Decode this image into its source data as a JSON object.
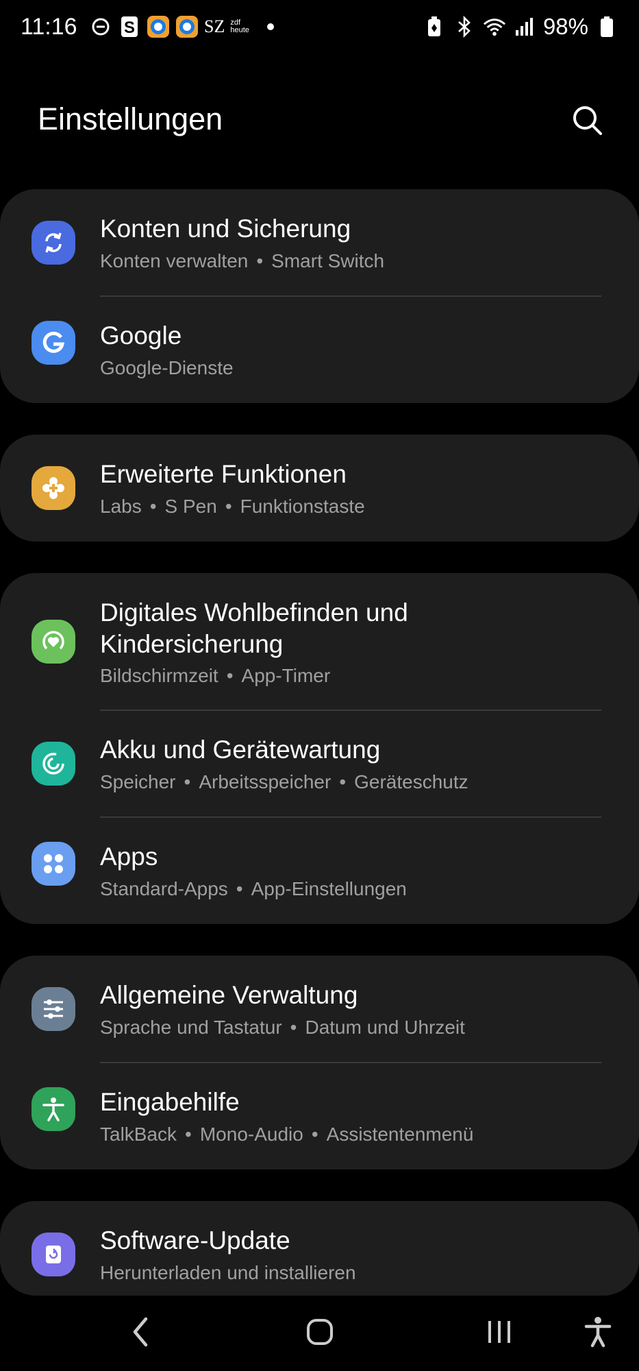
{
  "status": {
    "time": "11:16",
    "battery": "98%",
    "sz_label": "SZ",
    "zdf_label": "zdf heute"
  },
  "header": {
    "title": "Einstellungen"
  },
  "items": [
    {
      "title": "Konten und Sicherung",
      "subs": [
        "Konten verwalten",
        "Smart Switch"
      ],
      "icon": "sync-icon",
      "color": "#4a6ae0"
    },
    {
      "title": "Google",
      "subs": [
        "Google-Dienste"
      ],
      "icon": "google-icon",
      "color": "#4a8cf0"
    },
    {
      "title": "Erweiterte Funktionen",
      "subs": [
        "Labs",
        "S Pen",
        "Funktionstaste"
      ],
      "icon": "puzzle-icon",
      "color": "#e5a83c"
    },
    {
      "title": "Digitales Wohlbefinden und Kindersicherung",
      "title_line1": "Digitales Wohlbefinden und",
      "title_line2": "Kindersicherung",
      "subs": [
        "Bildschirmzeit",
        "App-Timer"
      ],
      "icon": "wellbeing-icon",
      "color": "#6cc15c"
    },
    {
      "title": "Akku und Gerätewartung",
      "subs": [
        "Speicher",
        "Arbeitsspeicher",
        "Geräteschutz"
      ],
      "icon": "device-care-icon",
      "color": "#1fb59a"
    },
    {
      "title": "Apps",
      "subs": [
        "Standard-Apps",
        "App-Einstellungen"
      ],
      "icon": "apps-icon",
      "color": "#6a9ef0"
    },
    {
      "title": "Allgemeine Verwaltung",
      "subs": [
        "Sprache und Tastatur",
        "Datum und Uhrzeit"
      ],
      "icon": "sliders-icon",
      "color": "#6b7f94"
    },
    {
      "title": "Eingabehilfe",
      "subs": [
        "TalkBack",
        "Mono-Audio",
        "Assistentenmenü"
      ],
      "icon": "accessibility-icon",
      "color": "#2fa35a"
    },
    {
      "title": "Software-Update",
      "subs": [
        "Herunterladen und installieren"
      ],
      "icon": "update-icon",
      "color": "#7a6ee8"
    }
  ],
  "sep": "•"
}
